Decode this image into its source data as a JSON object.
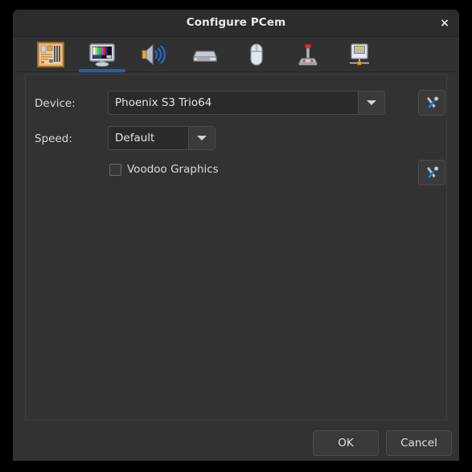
{
  "window": {
    "title": "Configure PCem",
    "close_label": "×",
    "close_icon": "close-icon"
  },
  "tabs": [
    {
      "name": "motherboard",
      "icon": "motherboard-icon",
      "active": false
    },
    {
      "name": "display",
      "icon": "monitor-icon",
      "active": true
    },
    {
      "name": "sound",
      "icon": "speaker-icon",
      "active": false
    },
    {
      "name": "drives",
      "icon": "floppy-drive-icon",
      "active": false
    },
    {
      "name": "mouse",
      "icon": "mouse-icon",
      "active": false
    },
    {
      "name": "joystick",
      "icon": "joystick-icon",
      "active": false
    },
    {
      "name": "network",
      "icon": "network-port-icon",
      "active": false
    }
  ],
  "form": {
    "device": {
      "label": "Device:",
      "value": "Phoenix S3 Trio64",
      "dropdown_icon": "chevron-down-icon",
      "config_icon": "tools-icon"
    },
    "speed": {
      "label": "Speed:",
      "value": "Default",
      "dropdown_icon": "chevron-down-icon"
    },
    "voodoo": {
      "label": "Voodoo Graphics",
      "checked": false,
      "config_icon": "tools-icon"
    }
  },
  "actions": {
    "ok_label": "OK",
    "cancel_label": "Cancel"
  },
  "colors": {
    "window_bg": "#323232",
    "titlebar_bg": "#2c2c2c",
    "accent": "#2060a8",
    "entry_bg": "#2a2a2a",
    "text": "#e0e0e0"
  }
}
